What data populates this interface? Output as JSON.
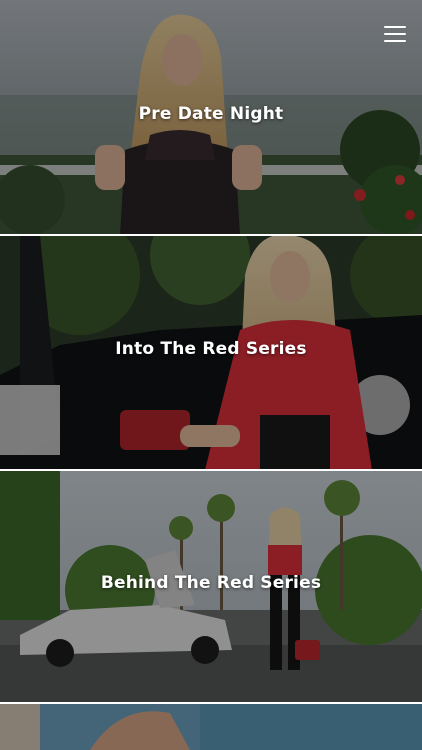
{
  "header": {
    "menu_icon": "hamburger-menu-icon"
  },
  "cards": [
    {
      "title": "Pre Date Night"
    },
    {
      "title": "Into The Red Series"
    },
    {
      "title": "Behind The Red Series"
    },
    {
      "title": ""
    }
  ],
  "colors": {
    "overlay": "#000000",
    "text": "#ffffff",
    "accent_red": "#e0313c"
  }
}
